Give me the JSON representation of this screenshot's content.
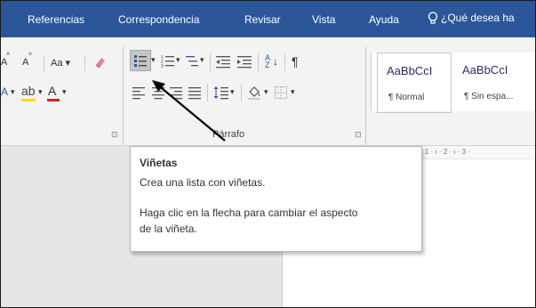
{
  "menu": {
    "tabs": [
      "Referencias",
      "Correspondencia",
      "Revisar",
      "Vista",
      "Ayuda"
    ],
    "tell_me": "¿Qué desea ha"
  },
  "font_group": {
    "size_grow": "A",
    "size_shrink": "A",
    "change_case": "Aa",
    "text_effects": "A",
    "font_color": "A",
    "highlight_icon": "highlighter-icon",
    "clear_format_icon": "eraser-icon",
    "launcher": "⊡"
  },
  "paragraph_group": {
    "label": "Párrafo",
    "launcher": "⊡",
    "sort_label": "A↓Z",
    "pilcrow": "¶"
  },
  "styles": [
    {
      "sample": "AaBbCcI",
      "name": "¶ Normal"
    },
    {
      "sample": "AaBbCcI",
      "name": "¶ Sin espa..."
    }
  ],
  "ruler": "· 1 · ı · 2 · ı · 3 ·",
  "tooltip": {
    "title": "Viñetas",
    "line1": "Crea una lista con viñetas.",
    "line2": "Haga clic en la flecha para cambiar el aspecto",
    "line3": "de la viñeta."
  },
  "colors": {
    "menubar": "#2b579a",
    "highlight_yellow": "#ffd800",
    "font_red": "#e02020"
  }
}
